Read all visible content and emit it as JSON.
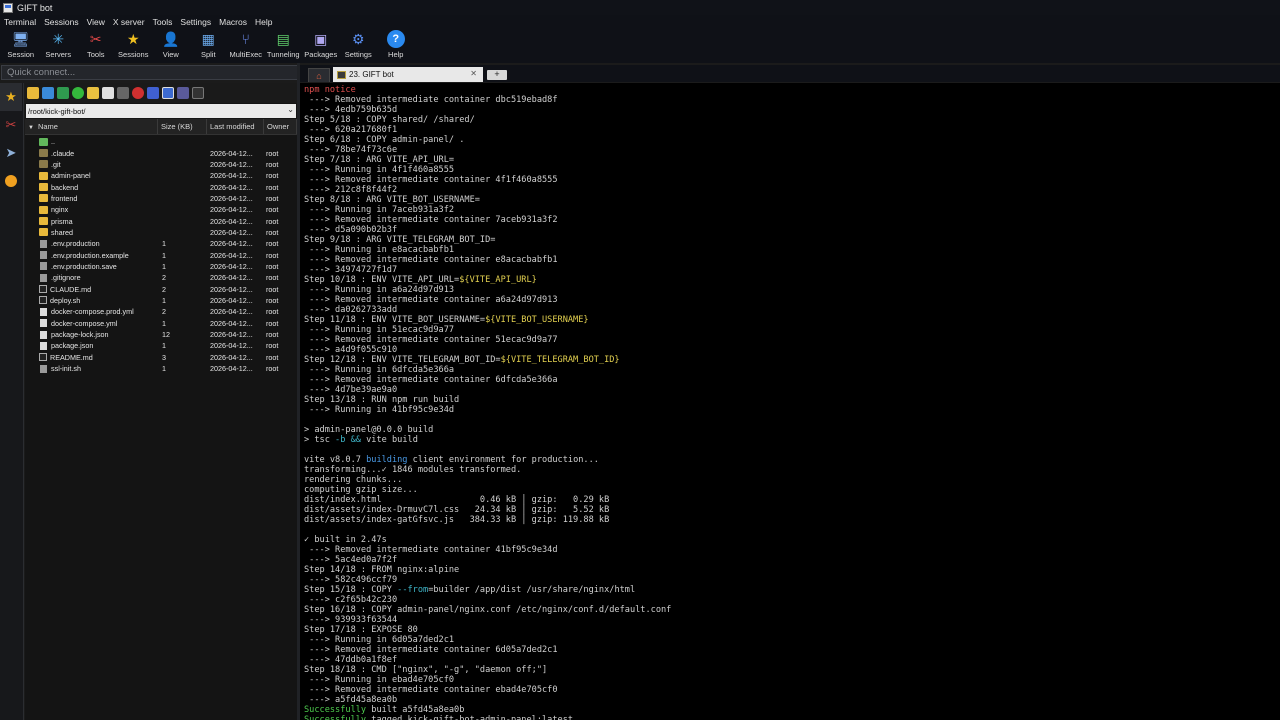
{
  "window": {
    "title": "GIFT bot"
  },
  "menu": [
    "Terminal",
    "Sessions",
    "View",
    "X server",
    "Tools",
    "Settings",
    "Macros",
    "Help"
  ],
  "toolbar": [
    {
      "label": "Session",
      "icon": "session-icon",
      "glyph": "🖥",
      "color": "#7fb0f0"
    },
    {
      "label": "Servers",
      "icon": "servers-icon",
      "glyph": "✳",
      "color": "#58b6f0"
    },
    {
      "label": "Tools",
      "icon": "tools-icon",
      "glyph": "✂",
      "color": "#e04848"
    },
    {
      "label": "Sessions",
      "icon": "sessions-star-icon",
      "glyph": "★",
      "color": "#f0c020"
    },
    {
      "label": "View",
      "icon": "view-icon",
      "glyph": "👤",
      "color": "#9ad0f0"
    },
    {
      "label": "Split",
      "icon": "split-icon",
      "glyph": "▦",
      "color": "#6aa8e8"
    },
    {
      "label": "MultiExec",
      "icon": "multiexec-icon",
      "glyph": "⑂",
      "color": "#6f8ff0"
    },
    {
      "label": "Tunneling",
      "icon": "tunneling-icon",
      "glyph": "▤",
      "color": "#5ecb6a"
    },
    {
      "label": "Packages",
      "icon": "packages-icon",
      "glyph": "▣",
      "color": "#b0a8f0"
    },
    {
      "label": "Settings",
      "icon": "settings-gear-icon",
      "glyph": "⚙",
      "color": "#5a8ff0"
    },
    {
      "label": "Help",
      "icon": "help-icon",
      "glyph": "?",
      "color": "#ffffff"
    }
  ],
  "quick_connect": {
    "placeholder": "Quick connect..."
  },
  "sftp": {
    "path": "/root/kick-gift-bot/",
    "columns": {
      "name": "Name",
      "size": "Size (KB)",
      "modified": "Last modified",
      "owner": "Owner"
    },
    "files": [
      {
        "name": "..",
        "type": "up",
        "size": "",
        "modified": "",
        "owner": ""
      },
      {
        "name": ".claude",
        "type": "folder-dim",
        "size": "",
        "modified": "2026-04-12...",
        "owner": "root"
      },
      {
        "name": ".git",
        "type": "folder-dim",
        "size": "",
        "modified": "2026-04-12...",
        "owner": "root"
      },
      {
        "name": "admin-panel",
        "type": "folder",
        "size": "",
        "modified": "2026-04-12...",
        "owner": "root"
      },
      {
        "name": "backend",
        "type": "folder",
        "size": "",
        "modified": "2026-04-12...",
        "owner": "root"
      },
      {
        "name": "frontend",
        "type": "folder",
        "size": "",
        "modified": "2026-04-12...",
        "owner": "root"
      },
      {
        "name": "nginx",
        "type": "folder",
        "size": "",
        "modified": "2026-04-12...",
        "owner": "root"
      },
      {
        "name": "prisma",
        "type": "folder",
        "size": "",
        "modified": "2026-04-12...",
        "owner": "root"
      },
      {
        "name": "shared",
        "type": "folder",
        "size": "",
        "modified": "2026-04-12...",
        "owner": "root"
      },
      {
        "name": ".env.production",
        "type": "file",
        "size": "1",
        "modified": "2026-04-12...",
        "owner": "root"
      },
      {
        "name": ".env.production.example",
        "type": "file",
        "size": "1",
        "modified": "2026-04-12...",
        "owner": "root"
      },
      {
        "name": ".env.production.save",
        "type": "file",
        "size": "1",
        "modified": "2026-04-12...",
        "owner": "root"
      },
      {
        "name": ".gitignore",
        "type": "file",
        "size": "2",
        "modified": "2026-04-12...",
        "owner": "root"
      },
      {
        "name": "CLAUDE.md",
        "type": "md",
        "size": "2",
        "modified": "2026-04-12...",
        "owner": "root"
      },
      {
        "name": "deploy.sh",
        "type": "md",
        "size": "1",
        "modified": "2026-04-12...",
        "owner": "root"
      },
      {
        "name": "docker-compose.prod.yml",
        "type": "doc",
        "size": "2",
        "modified": "2026-04-12...",
        "owner": "root"
      },
      {
        "name": "docker-compose.yml",
        "type": "doc",
        "size": "1",
        "modified": "2026-04-12...",
        "owner": "root"
      },
      {
        "name": "package-lock.json",
        "type": "doc",
        "size": "12",
        "modified": "2026-04-12...",
        "owner": "root"
      },
      {
        "name": "package.json",
        "type": "doc",
        "size": "1",
        "modified": "2026-04-12...",
        "owner": "root"
      },
      {
        "name": "README.md",
        "type": "md",
        "size": "3",
        "modified": "2026-04-12...",
        "owner": "root"
      },
      {
        "name": "ssl-init.sh",
        "type": "file",
        "size": "1",
        "modified": "2026-04-12...",
        "owner": "root"
      }
    ]
  },
  "terminal_tab": {
    "label": "23. GIFT bot"
  },
  "terminal": [
    [
      [
        "npm notice",
        "red"
      ]
    ],
    [
      [
        " ---> Removed intermediate container dbc519ebad8f",
        ""
      ]
    ],
    [
      [
        " ---> 4edb759b635d",
        ""
      ]
    ],
    [
      [
        "Step 5/18 : COPY shared/ /shared/",
        ""
      ]
    ],
    [
      [
        " ---> 620a217680f1",
        ""
      ]
    ],
    [
      [
        "Step 6/18 : COPY admin-panel/ .",
        ""
      ]
    ],
    [
      [
        " ---> 78be74f73c6e",
        ""
      ]
    ],
    [
      [
        "Step 7/18 : ARG VITE_API_URL=",
        ""
      ]
    ],
    [
      [
        " ---> Running in 4f1f460a8555",
        ""
      ]
    ],
    [
      [
        " ---> Removed intermediate container 4f1f460a8555",
        ""
      ]
    ],
    [
      [
        " ---> 212c8f8f44f2",
        ""
      ]
    ],
    [
      [
        "Step 8/18 : ARG VITE_BOT_USERNAME=",
        ""
      ]
    ],
    [
      [
        " ---> Running in 7aceb931a3f2",
        ""
      ]
    ],
    [
      [
        " ---> Removed intermediate container 7aceb931a3f2",
        ""
      ]
    ],
    [
      [
        " ---> d5a090b02b3f",
        ""
      ]
    ],
    [
      [
        "Step 9/18 : ARG VITE_TELEGRAM_BOT_ID=",
        ""
      ]
    ],
    [
      [
        " ---> Running in e8acacbabfb1",
        ""
      ]
    ],
    [
      [
        " ---> Removed intermediate container e8acacbabfb1",
        ""
      ]
    ],
    [
      [
        " ---> 34974727f1d7",
        ""
      ]
    ],
    [
      [
        "Step 10/18 : ENV VITE_API_URL=",
        ""
      ],
      [
        "${VITE_API_URL}",
        "yellow"
      ]
    ],
    [
      [
        " ---> Running in a6a24d97d913",
        ""
      ]
    ],
    [
      [
        " ---> Removed intermediate container a6a24d97d913",
        ""
      ]
    ],
    [
      [
        " ---> da0262733add",
        ""
      ]
    ],
    [
      [
        "Step 11/18 : ENV VITE_BOT_USERNAME=",
        ""
      ],
      [
        "${VITE_BOT_USERNAME}",
        "yellow"
      ]
    ],
    [
      [
        " ---> Running in 51ecac9d9a77",
        ""
      ]
    ],
    [
      [
        " ---> Removed intermediate container 51ecac9d9a77",
        ""
      ]
    ],
    [
      [
        " ---> a4d9f055c910",
        ""
      ]
    ],
    [
      [
        "Step 12/18 : ENV VITE_TELEGRAM_BOT_ID=",
        ""
      ],
      [
        "${VITE_TELEGRAM_BOT_ID}",
        "yellow"
      ]
    ],
    [
      [
        " ---> Running in 6dfcda5e366a",
        ""
      ]
    ],
    [
      [
        " ---> Removed intermediate container 6dfcda5e366a",
        ""
      ]
    ],
    [
      [
        " ---> 4d7be39ae9a0",
        ""
      ]
    ],
    [
      [
        "Step 13/18 : RUN npm run build",
        ""
      ]
    ],
    [
      [
        " ---> Running in 41bf95c9e34d",
        ""
      ]
    ],
    [
      [
        "",
        ""
      ]
    ],
    [
      [
        "> admin-panel@0.0.0 build",
        ""
      ]
    ],
    [
      [
        "> tsc ",
        ""
      ],
      [
        "-b",
        "cyan"
      ],
      [
        " ",
        ""
      ],
      [
        "&&",
        "cyan"
      ],
      [
        " vite build",
        ""
      ]
    ],
    [
      [
        "",
        ""
      ]
    ],
    [
      [
        "vite v8.0.7 ",
        ""
      ],
      [
        "building",
        "blue"
      ],
      [
        " client environment for production...",
        ""
      ]
    ],
    [
      [
        "transforming...✓ 1846 modules transformed.",
        ""
      ]
    ],
    [
      [
        "rendering chunks...",
        ""
      ]
    ],
    [
      [
        "computing gzip size...",
        ""
      ]
    ],
    [
      [
        "dist/index.html                   0.46 kB │ gzip:   0.29 kB",
        ""
      ]
    ],
    [
      [
        "dist/assets/index-DrmuvC7l.css   24.34 kB │ gzip:   5.52 kB",
        ""
      ]
    ],
    [
      [
        "dist/assets/index-gatGfsvc.js   384.33 kB │ gzip: 119.88 kB",
        ""
      ]
    ],
    [
      [
        "",
        ""
      ]
    ],
    [
      [
        "✓ built in 2.47s",
        ""
      ]
    ],
    [
      [
        " ---> Removed intermediate container 41bf95c9e34d",
        ""
      ]
    ],
    [
      [
        " ---> 5ac4ed0a7f2f",
        ""
      ]
    ],
    [
      [
        "Step 14/18 : FROM nginx:alpine",
        ""
      ]
    ],
    [
      [
        " ---> 582c496ccf79",
        ""
      ]
    ],
    [
      [
        "Step 15/18 : COPY ",
        ""
      ],
      [
        "--from",
        "cyan"
      ],
      [
        "=builder /app/dist /usr/share/nginx/html",
        ""
      ]
    ],
    [
      [
        " ---> c2f65b42c230",
        ""
      ]
    ],
    [
      [
        "Step 16/18 : COPY admin-panel/nginx.conf /etc/nginx/conf.d/default.conf",
        ""
      ]
    ],
    [
      [
        " ---> 939933f63544",
        ""
      ]
    ],
    [
      [
        "Step 17/18 : EXPOSE 80",
        ""
      ]
    ],
    [
      [
        " ---> Running in 6d05a7ded2c1",
        ""
      ]
    ],
    [
      [
        " ---> Removed intermediate container 6d05a7ded2c1",
        ""
      ]
    ],
    [
      [
        " ---> 47ddb0a1f8ef",
        ""
      ]
    ],
    [
      [
        "Step 18/18 : CMD [\"nginx\", \"-g\", \"daemon off;\"]",
        ""
      ]
    ],
    [
      [
        " ---> Running in ebad4e705cf0",
        ""
      ]
    ],
    [
      [
        " ---> Removed intermediate container ebad4e705cf0",
        ""
      ]
    ],
    [
      [
        " ---> a5fd45a8ea0b",
        ""
      ]
    ],
    [
      [
        "Successfully",
        "green"
      ],
      [
        " built a5fd45a8ea0b",
        ""
      ]
    ],
    [
      [
        "Successfully",
        "green"
      ],
      [
        " tagged kick-gift-bot-admin-panel:latest",
        ""
      ]
    ]
  ],
  "colors": {
    "background": "#000000",
    "text": "#d0d0d0",
    "npm_notice": "#e05050",
    "variable": "#e2d050",
    "success": "#4ecb4e"
  }
}
